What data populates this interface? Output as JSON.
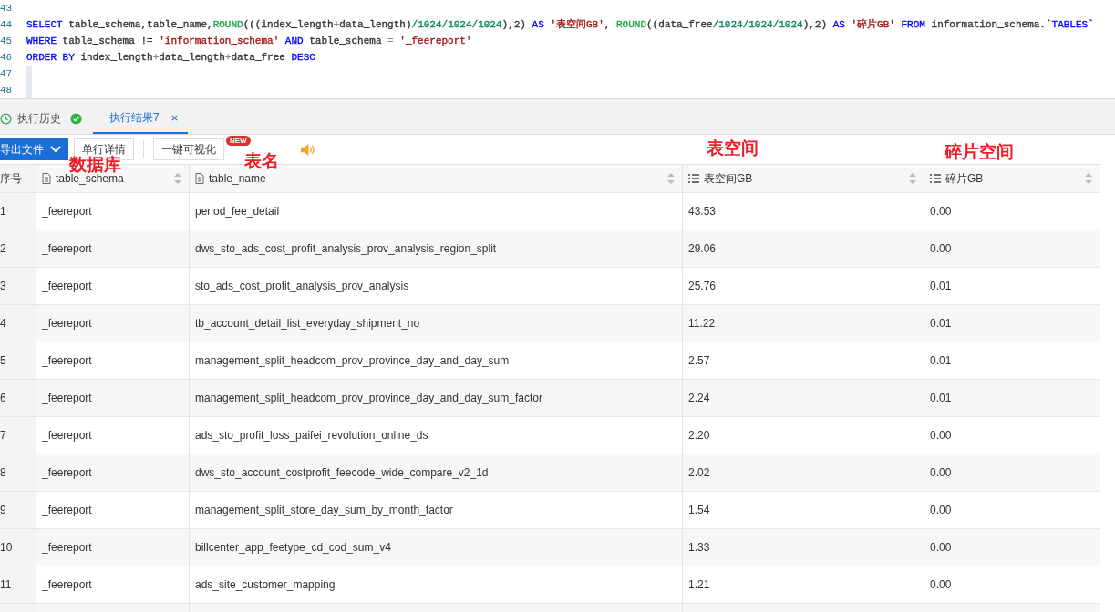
{
  "editor": {
    "lines": [
      {
        "number": "43"
      },
      {
        "number": "44",
        "tokens": [
          {
            "t": "SELECT ",
            "color": "#0000ff"
          },
          {
            "t": "table_schema,table_name,"
          },
          {
            "t": "ROUND",
            "color": "#22a34a"
          },
          {
            "t": "(((index_length"
          },
          {
            "t": "+",
            "color": "#888888"
          },
          {
            "t": "data_length)"
          },
          {
            "t": "/1024/1024/1024",
            "color": "#098658"
          },
          {
            "t": "),2) "
          },
          {
            "t": "AS ",
            "color": "#0000ff"
          },
          {
            "t": "'表空间GB'",
            "color": "#a31515"
          },
          {
            "t": ", "
          },
          {
            "t": "ROUND",
            "color": "#22a34a"
          },
          {
            "t": "((data_free"
          },
          {
            "t": "/1024/1024/1024",
            "color": "#098658"
          },
          {
            "t": "),2) "
          },
          {
            "t": "AS ",
            "color": "#0000ff"
          },
          {
            "t": "'碎片GB' ",
            "color": "#a31515"
          },
          {
            "t": "FROM ",
            "color": "#0000ff"
          },
          {
            "t": "information_schema."
          },
          {
            "t": "`TABLES`",
            "color": "#0000ff"
          }
        ]
      },
      {
        "number": "45",
        "tokens": [
          {
            "t": "WHERE ",
            "color": "#0000ff"
          },
          {
            "t": "table_schema != "
          },
          {
            "t": "'information_schema' ",
            "color": "#a31515"
          },
          {
            "t": "AND ",
            "color": "#0000ff"
          },
          {
            "t": "table_schema "
          },
          {
            "t": "= ",
            "color": "#888888"
          },
          {
            "t": "'_feereport'",
            "color": "#a31515"
          }
        ]
      },
      {
        "number": "46",
        "tokens": [
          {
            "t": "ORDER BY ",
            "color": "#0000ff"
          },
          {
            "t": "index_length"
          },
          {
            "t": "+",
            "color": "#888888"
          },
          {
            "t": "data_length"
          },
          {
            "t": "+",
            "color": "#888888"
          },
          {
            "t": "data_free "
          },
          {
            "t": "DESC",
            "color": "#0000ff"
          }
        ]
      },
      {
        "number": "47"
      },
      {
        "number": "48"
      }
    ]
  },
  "tabs": [
    {
      "label": "执行历史",
      "selected": false
    },
    {
      "label": "执行结果7",
      "selected": true
    }
  ],
  "toolbar": {
    "export_button": "导出文件",
    "row_detail_button": "单行详情",
    "visualize_button": "一键可视化",
    "new_badge": "NEW"
  },
  "annotations": [
    "数据库",
    "表名",
    "表空间",
    "碎片空间"
  ],
  "table": {
    "columns": [
      {
        "label": "序号",
        "kind": "index"
      },
      {
        "label": "table_schema",
        "kind": "text"
      },
      {
        "label": "table_name",
        "kind": "text"
      },
      {
        "label": "表空间GB",
        "kind": "number"
      },
      {
        "label": "碎片GB",
        "kind": "number"
      }
    ],
    "rows": [
      [
        "1",
        "_feereport",
        "period_fee_detail",
        "43.53",
        "0.00"
      ],
      [
        "2",
        "_feereport",
        "dws_sto_ads_cost_profit_analysis_prov_analysis_region_split",
        "29.06",
        "0.00"
      ],
      [
        "3",
        "_feereport",
        "sto_ads_cost_profit_analysis_prov_analysis",
        "25.76",
        "0.01"
      ],
      [
        "4",
        "_feereport",
        "tb_account_detail_list_everyday_shipment_no",
        "11.22",
        "0.01"
      ],
      [
        "5",
        "_feereport",
        "management_split_headcom_prov_province_day_and_day_sum",
        "2.57",
        "0.01"
      ],
      [
        "6",
        "_feereport",
        "management_split_headcom_prov_province_day_and_day_sum_factor",
        "2.24",
        "0.01"
      ],
      [
        "7",
        "_feereport",
        "ads_sto_profit_loss_paifei_revolution_online_ds",
        "2.20",
        "0.00"
      ],
      [
        "8",
        "_feereport",
        "dws_sto_account_costprofit_feecode_wide_compare_v2_1d",
        "2.02",
        "0.00"
      ],
      [
        "9",
        "_feereport",
        "management_split_store_day_sum_by_month_factor",
        "1.54",
        "0.00"
      ],
      [
        "10",
        "_feereport",
        "billcenter_app_feetype_cd_cod_sum_v4",
        "1.33",
        "0.00"
      ],
      [
        "11",
        "_feereport",
        "ads_site_customer_mapping",
        "1.21",
        "0.00"
      ]
    ]
  }
}
